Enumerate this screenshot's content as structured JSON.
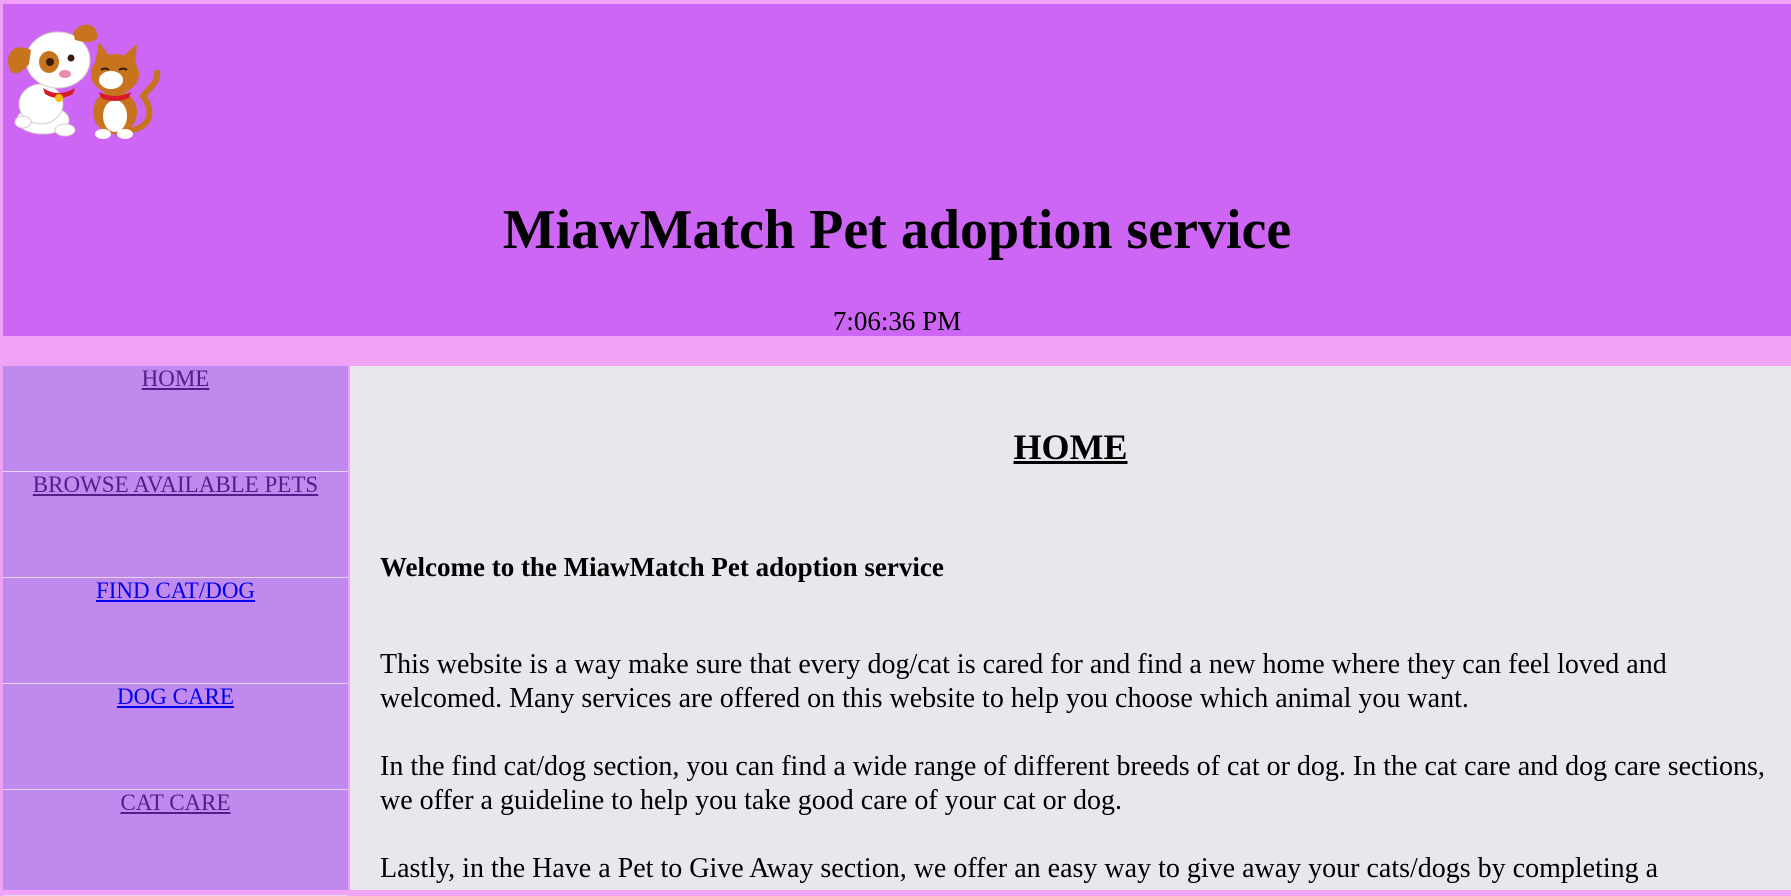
{
  "header": {
    "title": "MiawMatch Pet adoption service",
    "time": "7:06:36 PM",
    "logo_icon": "dog-and-cat-logo",
    "background_color": "#cd66f5"
  },
  "sidebar": {
    "background_color": "#c089ee",
    "items": [
      {
        "label": "HOME",
        "visited": true
      },
      {
        "label": "BROWSE AVAILABLE PETS",
        "visited": true
      },
      {
        "label": "FIND CAT/DOG",
        "visited": false
      },
      {
        "label": "DOG CARE",
        "visited": false
      },
      {
        "label": "CAT CARE",
        "visited": true
      }
    ]
  },
  "main": {
    "heading": "HOME",
    "welcome": "Welcome to the MiawMatch Pet adoption service",
    "paragraphs": [
      "This website is a way make sure that every dog/cat is cared for and find a new home where they can feel loved and welcomed. Many services are offered on this website to help you choose which animal you want.",
      "In the find cat/dog section, you can find a wide range of different breeds of cat or dog. In the cat care and dog care sections, we offer a guideline to help you take good care of your cat or dog.",
      "Lastly, in the Have a Pet to Give Away section, we offer an easy way to give away your cats/dogs by completing a"
    ],
    "background_color": "#eae6ee"
  }
}
